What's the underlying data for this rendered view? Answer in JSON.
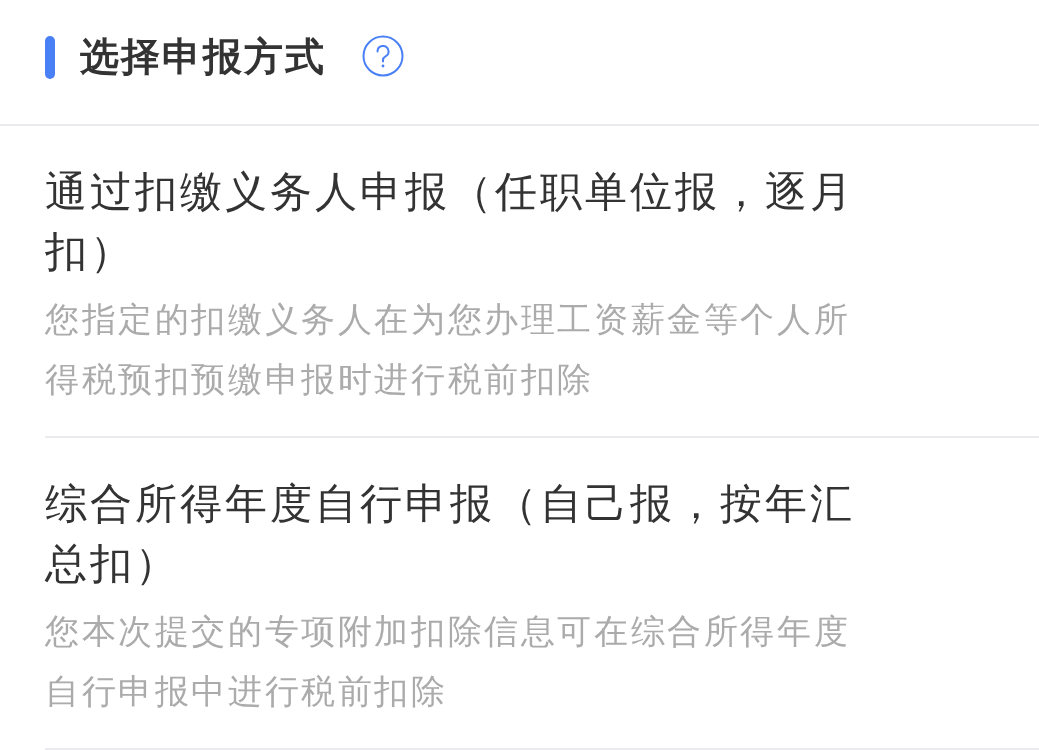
{
  "section": {
    "title": "选择申报方式"
  },
  "options": [
    {
      "title": "通过扣缴义务人申报（任职单位报，逐月扣）",
      "description": "您指定的扣缴义务人在为您办理工资薪金等个人所得税预扣预缴申报时进行税前扣除"
    },
    {
      "title": "综合所得年度自行申报（自己报，按年汇总扣）",
      "description": "您本次提交的专项附加扣除信息可在综合所得年度自行申报中进行税前扣除"
    }
  ]
}
